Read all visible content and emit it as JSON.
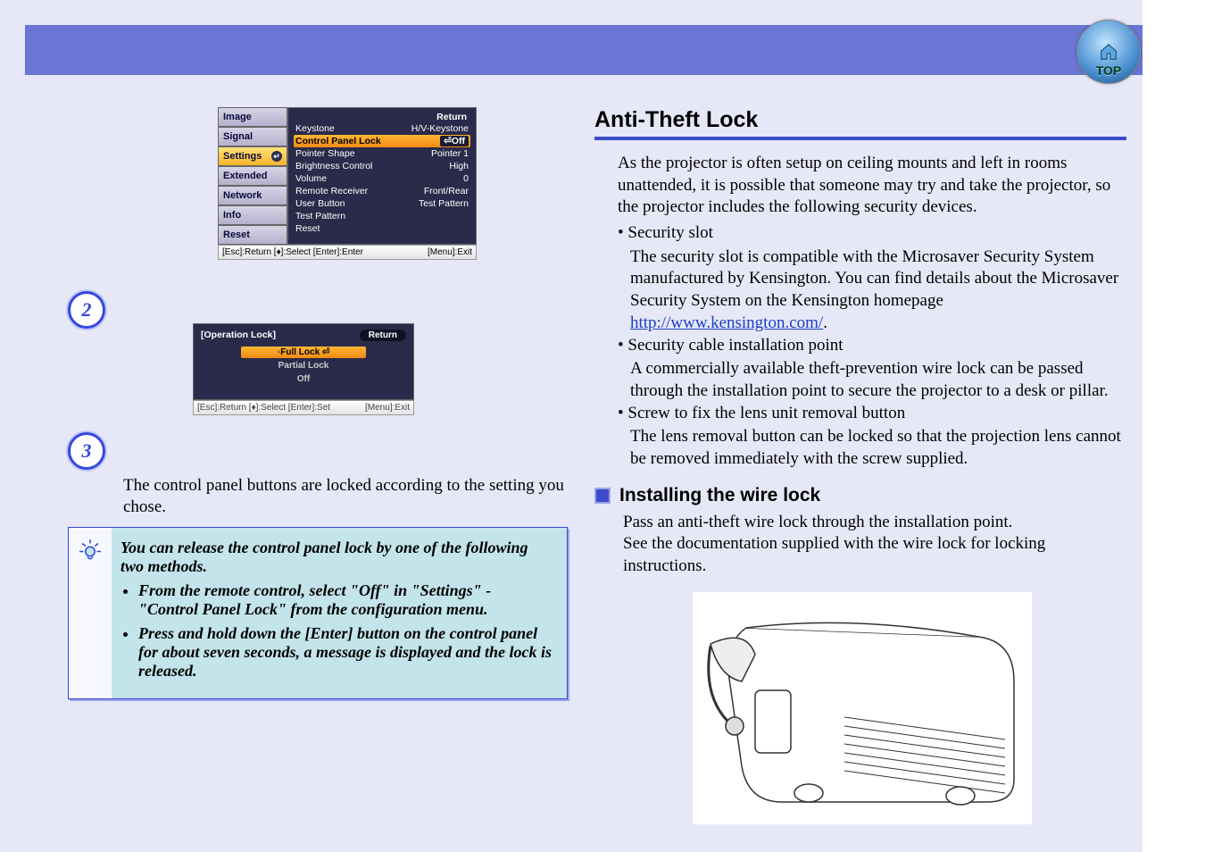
{
  "header": {
    "top_label": "TOP"
  },
  "left": {
    "step2_label": "2",
    "step3_label": "3",
    "body_text": "The control panel buttons are locked according to the setting you chose.",
    "note_intro": "You can release the control panel lock by one of the following two methods.",
    "note_b1": "From the remote control, select \"Off\" in \"Settings\" - \"Control Panel Lock\" from the configuration menu.",
    "note_b2": "Press and hold down the [Enter] button on the control panel for about seven seconds, a message is displayed and the lock is released."
  },
  "osd1": {
    "tabs": [
      "Image",
      "Signal",
      "Settings",
      "Extended",
      "Network",
      "Info",
      "Reset"
    ],
    "selected_tab": "Settings",
    "return": "Return",
    "rows": [
      {
        "label": "Keystone",
        "value": "H/V-Keystone"
      },
      {
        "label": "Control Panel Lock",
        "value": "Off",
        "hl": true
      },
      {
        "label": "Pointer Shape",
        "value": "Pointer 1"
      },
      {
        "label": "Brightness Control",
        "value": "High"
      },
      {
        "label": "Volume",
        "value": "0"
      },
      {
        "label": "Remote Receiver",
        "value": "Front/Rear"
      },
      {
        "label": "User Button",
        "value": "Test Pattern"
      },
      {
        "label": "Test Pattern",
        "value": ""
      },
      {
        "label": "Reset",
        "value": ""
      }
    ],
    "help_left": "[Esc]:Return  [♦]:Select  [Enter]:Enter",
    "help_right": "[Menu]:Exit"
  },
  "osd2": {
    "title": "[Operation Lock]",
    "return": "Return",
    "opts": [
      "Full Lock",
      "Partial Lock",
      "Off"
    ],
    "help_left": "[Esc]:Return  [♦]:Select  [Enter]:Set",
    "help_right": "[Menu]:Exit"
  },
  "right": {
    "title": "Anti-Theft Lock",
    "intro": "As the projector is often setup on ceiling mounts and left in rooms unattended, it is possible that someone may try and take the projector, so the projector includes the following security devices.",
    "b1_label": "Security slot",
    "b1_body": "The security slot is compatible with the Microsaver Security System manufactured by Kensington. You can find details about the Microsaver Security System on the Kensington homepage ",
    "b1_link": "http://www.kensington.com/",
    "b2_label": "Security cable installation point",
    "b2_body": "A commercially available theft-prevention wire lock can be passed through the installation point to secure the projector to a desk or pillar.",
    "b3_label": "Screw to fix the lens unit removal button",
    "b3_body": "The lens removal button can be locked so that the projection lens cannot be removed immediately with the screw supplied.",
    "sub_title": "Installing the wire lock",
    "sub_p1": "Pass an anti-theft wire lock through the installation point.",
    "sub_p2": "See the documentation supplied with the wire lock for locking instructions."
  }
}
